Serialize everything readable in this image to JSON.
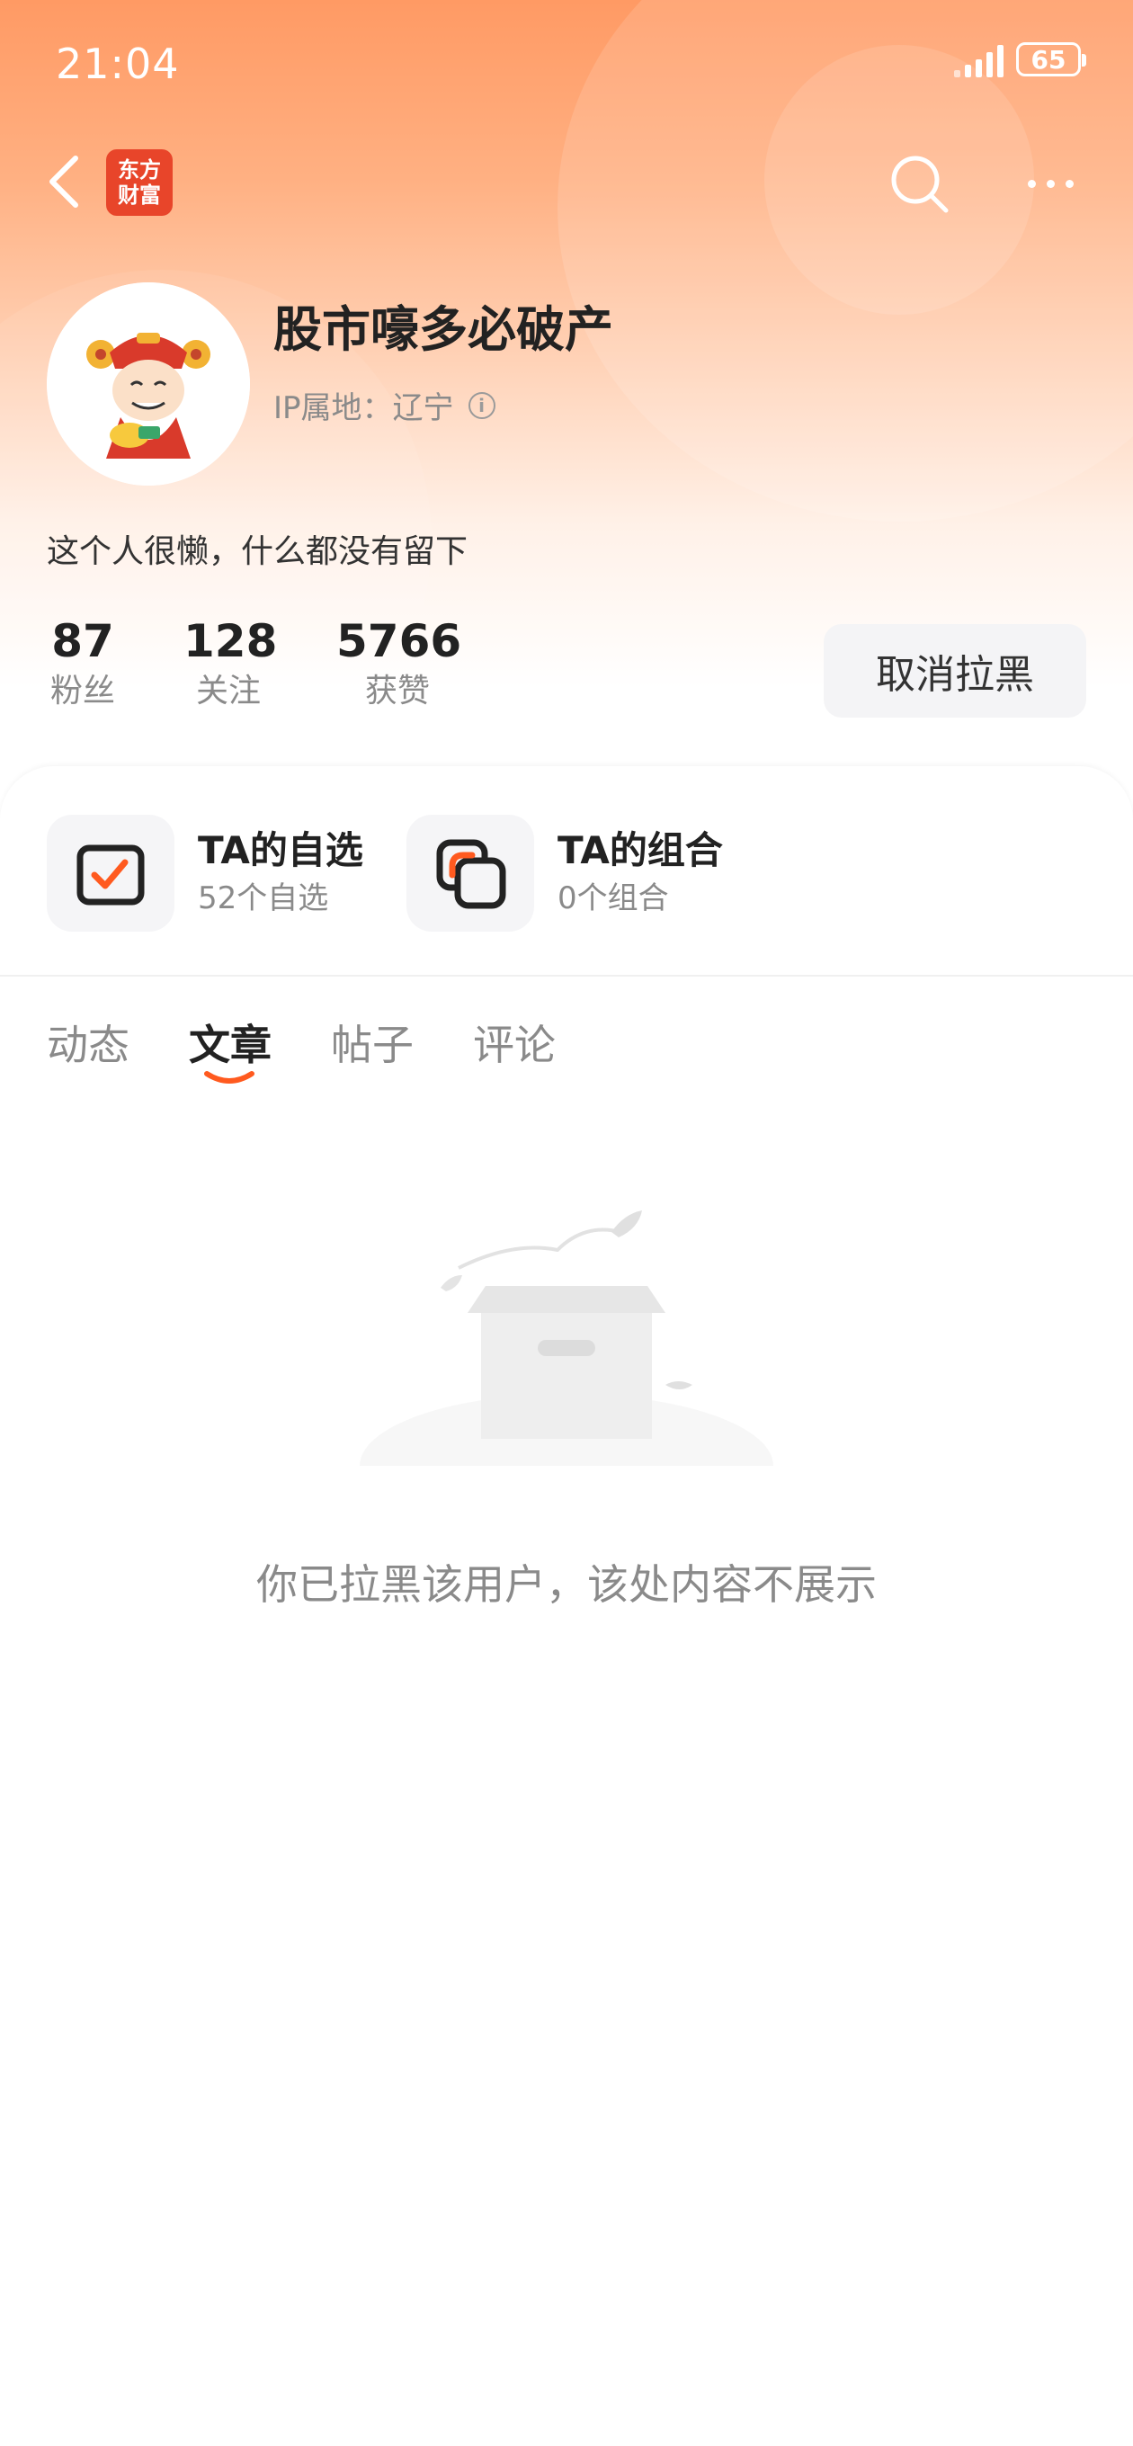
{
  "status_bar": {
    "time": "21:04",
    "battery": "65"
  },
  "header": {
    "logo_line1": "东方",
    "logo_line2": "财富"
  },
  "profile": {
    "nickname": "股市嚎多必破产",
    "ip_location": "IP属地：辽宁",
    "bio": "这个人很懒，什么都没有留下",
    "stats": [
      {
        "value": "87",
        "label": "粉丝"
      },
      {
        "value": "128",
        "label": "关注"
      },
      {
        "value": "5766",
        "label": "获赞"
      }
    ],
    "unblock_label": "取消拉黑"
  },
  "features": [
    {
      "title": "TA的自选",
      "subtitle": "52个自选"
    },
    {
      "title": "TA的组合",
      "subtitle": "0个组合"
    }
  ],
  "tabs": [
    {
      "label": "动态"
    },
    {
      "label": "文章"
    },
    {
      "label": "帖子"
    },
    {
      "label": "评论"
    }
  ],
  "active_tab": "文章",
  "empty_message": "你已拉黑该用户，该处内容不展示",
  "colors": {
    "accent": "#ff5a1f",
    "header_top": "#ff9a64",
    "logo_bg": "#e8452a"
  }
}
